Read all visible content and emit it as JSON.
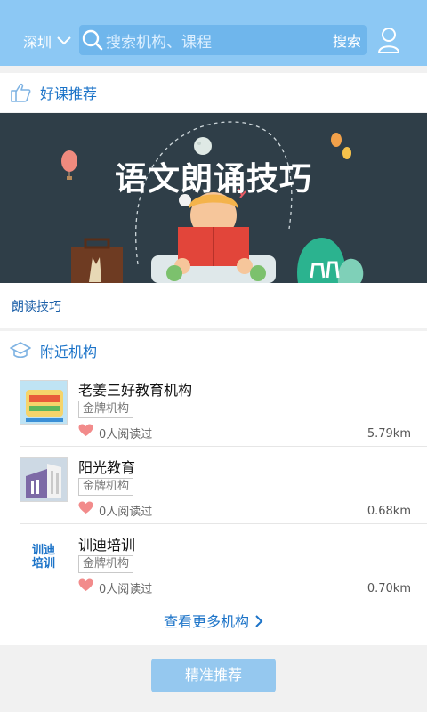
{
  "header": {
    "city": "深圳",
    "search_placeholder": "搜索机构、课程",
    "search_button": "搜索"
  },
  "recommended_section": {
    "title": "好课推荐",
    "banner_title": "语文朗诵技巧",
    "caption": "朗读技巧"
  },
  "nearby_section": {
    "title": "附近机构",
    "items": [
      {
        "name": "老姜三好教育机构",
        "badge": "金牌机构",
        "reads": "0人阅读过",
        "distance": "5.79km"
      },
      {
        "name": "阳光教育",
        "badge": "金牌机构",
        "reads": "0人阅读过",
        "distance": "0.68km"
      },
      {
        "name": "训迪培训",
        "badge": "金牌机构",
        "reads": "0人阅读过",
        "distance": "0.70km",
        "logo_text": "训迪\n培训"
      }
    ],
    "more_label": "查看更多机构"
  },
  "bottom": {
    "recommend_button": "精准推荐"
  },
  "colors": {
    "header": "#8cc8f4",
    "accent": "#1b73c8",
    "heart": "#f28b8b"
  }
}
